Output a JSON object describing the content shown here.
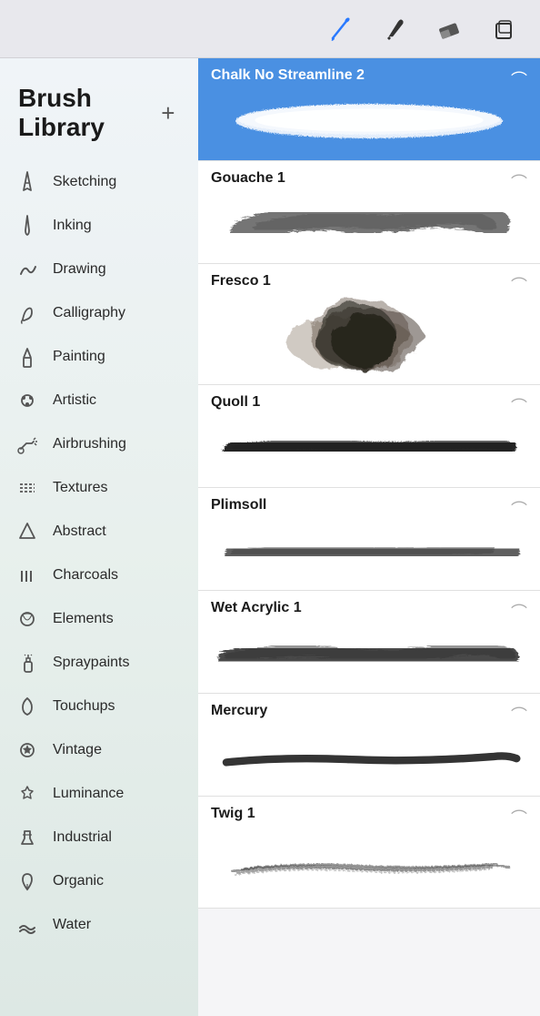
{
  "toolbar": {
    "icons": [
      {
        "name": "paintbrush",
        "symbol": "✏️"
      },
      {
        "name": "inkpen",
        "symbol": "🖊️"
      },
      {
        "name": "eraser",
        "symbol": "⌫"
      },
      {
        "name": "layers",
        "symbol": "⧉"
      }
    ]
  },
  "sidebar": {
    "title": "Brush Library",
    "add_label": "+",
    "items": [
      {
        "id": "sketching",
        "label": "Sketching"
      },
      {
        "id": "inking",
        "label": "Inking"
      },
      {
        "id": "drawing",
        "label": "Drawing"
      },
      {
        "id": "calligraphy",
        "label": "Calligraphy"
      },
      {
        "id": "painting",
        "label": "Painting"
      },
      {
        "id": "artistic",
        "label": "Artistic"
      },
      {
        "id": "airbrushing",
        "label": "Airbrushing"
      },
      {
        "id": "textures",
        "label": "Textures"
      },
      {
        "id": "abstract",
        "label": "Abstract"
      },
      {
        "id": "charcoals",
        "label": "Charcoals"
      },
      {
        "id": "elements",
        "label": "Elements"
      },
      {
        "id": "spraypaints",
        "label": "Spraypaints"
      },
      {
        "id": "touchups",
        "label": "Touchups"
      },
      {
        "id": "vintage",
        "label": "Vintage"
      },
      {
        "id": "luminance",
        "label": "Luminance"
      },
      {
        "id": "industrial",
        "label": "Industrial"
      },
      {
        "id": "organic",
        "label": "Organic"
      },
      {
        "id": "water",
        "label": "Water"
      }
    ]
  },
  "brushes": {
    "items": [
      {
        "id": "chalk",
        "name": "Chalk No Streamline  2",
        "selected": true
      },
      {
        "id": "gouache",
        "name": "Gouache 1",
        "selected": false
      },
      {
        "id": "fresco",
        "name": "Fresco 1",
        "selected": false
      },
      {
        "id": "quoll",
        "name": "Quoll 1",
        "selected": false
      },
      {
        "id": "plimsoll",
        "name": "Plimsoll",
        "selected": false
      },
      {
        "id": "wet-acrylic",
        "name": "Wet Acrylic 1",
        "selected": false
      },
      {
        "id": "mercury",
        "name": "Mercury",
        "selected": false
      },
      {
        "id": "twig",
        "name": "Twig 1",
        "selected": false
      }
    ]
  }
}
